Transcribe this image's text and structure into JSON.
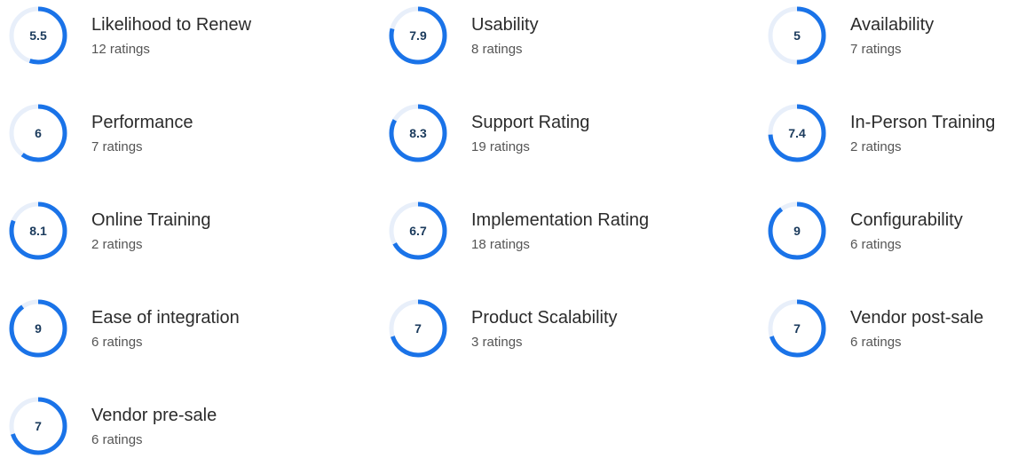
{
  "colors": {
    "ring_fill": "#1a73e8",
    "ring_track": "#e8effa",
    "score_text": "#1a3a5c",
    "label_text": "#2b2b2b",
    "count_text": "#555555"
  },
  "metrics": [
    {
      "name": "Likelihood to Renew",
      "score": "5.5",
      "score_value": 5.5,
      "count": "12 ratings"
    },
    {
      "name": "Usability",
      "score": "7.9",
      "score_value": 7.9,
      "count": "8 ratings"
    },
    {
      "name": "Availability",
      "score": "5",
      "score_value": 5,
      "count": "7 ratings"
    },
    {
      "name": "Performance",
      "score": "6",
      "score_value": 6,
      "count": "7 ratings"
    },
    {
      "name": "Support Rating",
      "score": "8.3",
      "score_value": 8.3,
      "count": "19 ratings"
    },
    {
      "name": "In-Person Training",
      "score": "7.4",
      "score_value": 7.4,
      "count": "2 ratings"
    },
    {
      "name": "Online Training",
      "score": "8.1",
      "score_value": 8.1,
      "count": "2 ratings"
    },
    {
      "name": "Implementation Rating",
      "score": "6.7",
      "score_value": 6.7,
      "count": "18 ratings"
    },
    {
      "name": "Configurability",
      "score": "9",
      "score_value": 9,
      "count": "6 ratings"
    },
    {
      "name": "Ease of integration",
      "score": "9",
      "score_value": 9,
      "count": "6 ratings"
    },
    {
      "name": "Product Scalability",
      "score": "7",
      "score_value": 7,
      "count": "3 ratings"
    },
    {
      "name": "Vendor post-sale",
      "score": "7",
      "score_value": 7,
      "count": "6 ratings"
    },
    {
      "name": "Vendor pre-sale",
      "score": "7",
      "score_value": 7,
      "count": "6 ratings"
    }
  ],
  "score_max": 10
}
